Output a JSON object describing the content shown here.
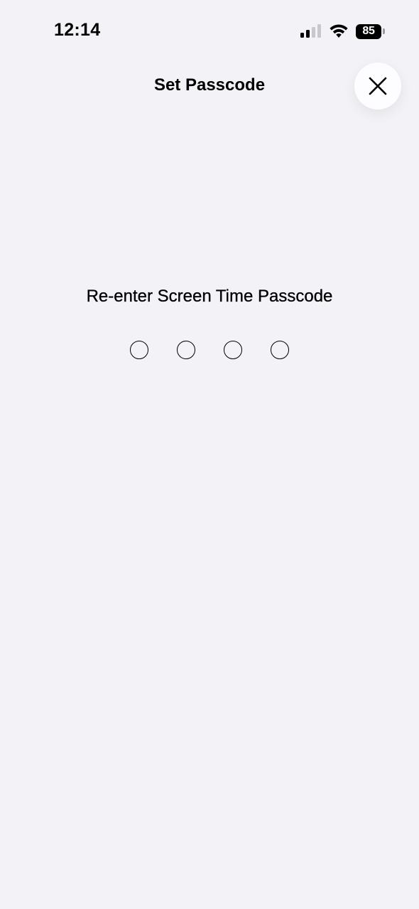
{
  "status_bar": {
    "time": "12:14",
    "battery_level": "85",
    "icons": [
      "cellular-signal-icon",
      "wifi-icon",
      "battery-icon"
    ]
  },
  "header": {
    "title": "Set Passcode",
    "close_icon": "close-icon"
  },
  "main": {
    "prompt": "Re-enter Screen Time Passcode",
    "passcode_length": 4,
    "digits_entered": 0
  },
  "colors": {
    "background": "#f2f2f7",
    "text": "#000000",
    "close_button_bg": "#fdfdff"
  }
}
